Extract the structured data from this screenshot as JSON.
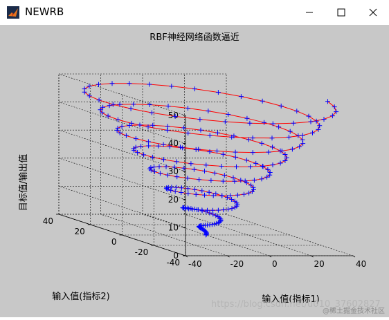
{
  "window": {
    "title": "NEWRB",
    "controls": {
      "minimize": "minimize",
      "maximize": "maximize",
      "close": "close"
    }
  },
  "watermark": {
    "url": "https://blog.csdn.net/u010_37602827",
    "badge": "@稀土掘金技术社区"
  },
  "chart_data": {
    "type": "line3d",
    "title": "RBF神经网络函数逼近",
    "xlabel": "输入值(指标1)",
    "ylabel": "输入值(指标2)",
    "zlabel": "目标值/输出值",
    "xlim": [
      -40,
      40
    ],
    "ylim": [
      -40,
      40
    ],
    "zlim": [
      0,
      50
    ],
    "xticks": [
      "-40",
      "-20",
      "0",
      "20",
      "40"
    ],
    "yticks": [
      "-40",
      "-20",
      "0",
      "20",
      "40"
    ],
    "zticks": [
      "0",
      "10",
      "20",
      "30",
      "40",
      "50"
    ],
    "grid": true,
    "series": [
      {
        "style": "blue +",
        "color": "#0000ff",
        "param": "t from 0 to 50",
        "x": "t*cos(t)",
        "y": "t*sin(t)",
        "z": "t"
      },
      {
        "style": "red line",
        "color": "#ff0000",
        "param": "t from 0 to 50",
        "x": "t*cos(t)",
        "y": "t*sin(t)",
        "z": "t"
      }
    ]
  }
}
